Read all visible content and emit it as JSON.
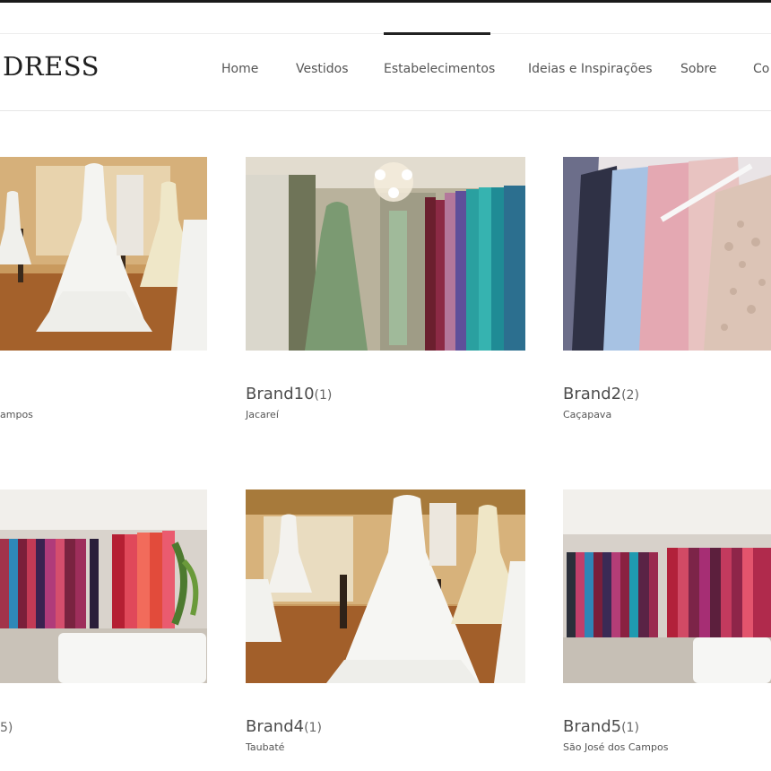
{
  "header": {
    "logo": "DRESS",
    "nav": [
      "Home",
      "Vestidos",
      "Estabelecimentos",
      "Ideias e Inspirações",
      "Sobre",
      "Co"
    ],
    "active_nav": "Estabelecimentos"
  },
  "cards": [
    {
      "name": "",
      "count": "",
      "city": "ampos",
      "image": "bridal-showroom"
    },
    {
      "name": "Brand10",
      "count": "(1)",
      "city": "Jacareí",
      "image": "green-gown-boutique"
    },
    {
      "name": "Brand2",
      "count": "(2)",
      "city": "Caçapava",
      "image": "pastel-dresses-rack"
    },
    {
      "name": "",
      "count": "5)",
      "city": "",
      "image": "colorful-dresses-store"
    },
    {
      "name": "Brand4",
      "count": "(1)",
      "city": "Taubaté",
      "image": "bridal-showroom"
    },
    {
      "name": "Brand5",
      "count": "(1)",
      "city": "São José dos Campos",
      "image": "colorful-dresses-store"
    }
  ]
}
